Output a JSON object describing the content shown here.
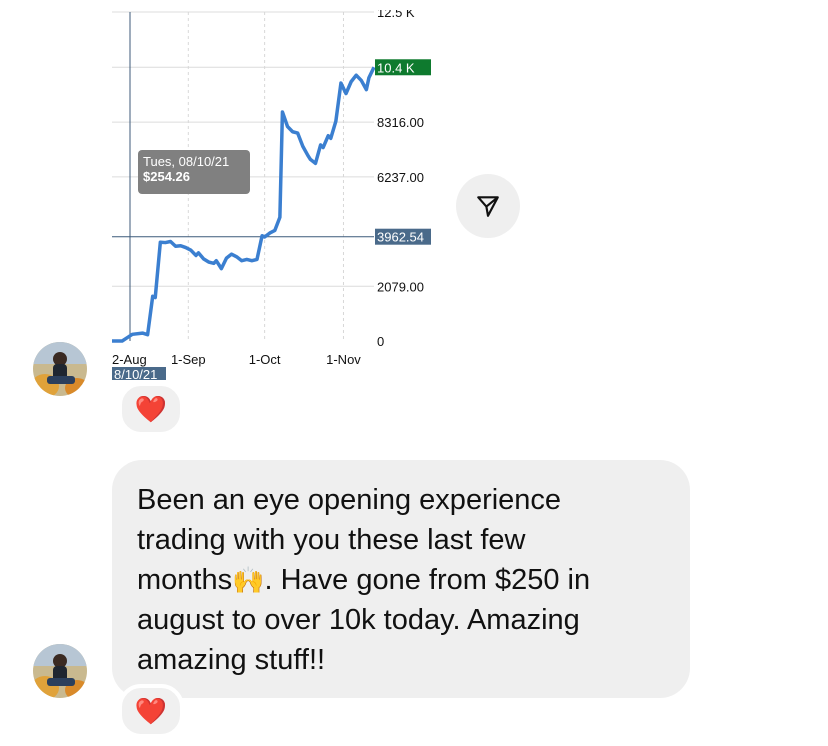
{
  "chart_data": {
    "type": "line",
    "x_ticks": [
      "2-Aug",
      "1-Sep",
      "1-Oct",
      "1-Nov"
    ],
    "y_ticks": [
      "12.5 K",
      "8316.00",
      "6237.00",
      "2079.00",
      "0"
    ],
    "ylim": [
      0,
      12500
    ],
    "grid": true,
    "series": [
      {
        "color": "#3b7fd0",
        "points": [
          [
            "2021-08-02",
            0
          ],
          [
            "2021-08-06",
            0
          ],
          [
            "2021-08-10",
            254.26
          ],
          [
            "2021-08-14",
            300
          ],
          [
            "2021-08-16",
            240
          ],
          [
            "2021-08-18",
            1700
          ],
          [
            "2021-08-19",
            1650
          ],
          [
            "2021-08-21",
            3750
          ],
          [
            "2021-08-23",
            3740
          ],
          [
            "2021-08-25",
            3780
          ],
          [
            "2021-08-27",
            3600
          ],
          [
            "2021-08-29",
            3620
          ],
          [
            "2021-08-31",
            3550
          ],
          [
            "2021-09-02",
            3450
          ],
          [
            "2021-09-04",
            3250
          ],
          [
            "2021-09-05",
            3350
          ],
          [
            "2021-09-07",
            3120
          ],
          [
            "2021-09-09",
            3000
          ],
          [
            "2021-09-11",
            2950
          ],
          [
            "2021-09-12",
            3050
          ],
          [
            "2021-09-14",
            2750
          ],
          [
            "2021-09-16",
            3150
          ],
          [
            "2021-09-18",
            3300
          ],
          [
            "2021-09-20",
            3200
          ],
          [
            "2021-09-22",
            3050
          ],
          [
            "2021-09-24",
            3100
          ],
          [
            "2021-09-26",
            3050
          ],
          [
            "2021-09-28",
            3100
          ],
          [
            "2021-09-30",
            4000
          ],
          [
            "2021-10-01",
            3950
          ],
          [
            "2021-10-03",
            4100
          ],
          [
            "2021-10-05",
            4200
          ],
          [
            "2021-10-07",
            4700
          ],
          [
            "2021-10-08",
            8700
          ],
          [
            "2021-10-10",
            8150
          ],
          [
            "2021-10-12",
            7950
          ],
          [
            "2021-10-14",
            7900
          ],
          [
            "2021-10-16",
            7400
          ],
          [
            "2021-10-18",
            7050
          ],
          [
            "2021-10-19",
            6900
          ],
          [
            "2021-10-21",
            6750
          ],
          [
            "2021-10-23",
            7450
          ],
          [
            "2021-10-24",
            7350
          ],
          [
            "2021-10-26",
            7800
          ],
          [
            "2021-10-27",
            7700
          ],
          [
            "2021-10-29",
            8350
          ],
          [
            "2021-10-31",
            9800
          ],
          [
            "2021-11-02",
            9400
          ],
          [
            "2021-11-04",
            9850
          ],
          [
            "2021-11-06",
            10100
          ],
          [
            "2021-11-08",
            9900
          ],
          [
            "2021-11-10",
            9550
          ],
          [
            "2021-11-11",
            10000
          ],
          [
            "2021-11-13",
            10400
          ]
        ]
      }
    ],
    "value_markers": [
      {
        "label": "10.4 K",
        "value": 10400,
        "color": "#0e7a2e"
      },
      {
        "label": "3962.54",
        "value": 3962.54,
        "color": "#4a6a8a"
      }
    ],
    "crosshair_date_label": "8/10/21",
    "tooltip": {
      "date": "Tues, 08/10/21",
      "value": "$254.26"
    }
  },
  "message": {
    "line1": "Been an eye opening experience",
    "line2": "trading with you these last few",
    "line3_a": "months",
    "emoji": "🙌",
    "line3_b": ". Have gone from $250 in",
    "line4": "august to over 10k today. Amazing",
    "line5": "amazing stuff!!"
  },
  "reactions": {
    "image_reaction": "❤️",
    "message_reaction": "❤️"
  },
  "icons": {
    "send": "paper-plane-icon",
    "avatar": "user-avatar"
  }
}
